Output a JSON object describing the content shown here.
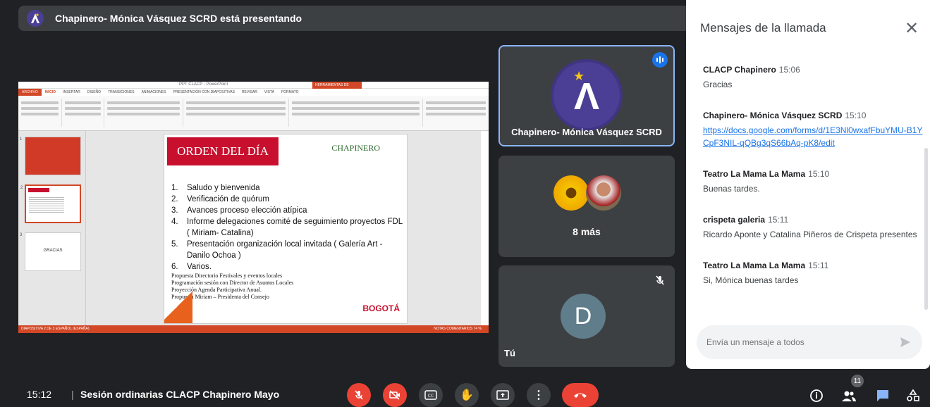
{
  "banner": {
    "text": "Chapinero- Mónica Vásquez SCRD está presentando"
  },
  "presentation": {
    "window_title": "PPT CLACP - PowerPoint",
    "drawing_tools": "HERRAMIENTAS DE DIBUJO",
    "tabs": [
      "ARCHIVO",
      "INICIO",
      "INSERTAR",
      "DISEÑO",
      "TRANSICIONES",
      "ANIMACIONES",
      "PRESENTACIÓN CON DIAPOSITIVAS",
      "REVISAR",
      "VISTA",
      "FORMATO"
    ],
    "thumb3_text": "GRACIAS",
    "slide": {
      "title": "ORDEN DEL DÍA",
      "header_right": "CHAPINERO",
      "items": [
        {
          "num": "1.",
          "text": "Saludo y bienvenida"
        },
        {
          "num": "2.",
          "text": "Verificación de quórum"
        },
        {
          "num": "3.",
          "text": "Avances proceso elección atípica"
        },
        {
          "num": "4.",
          "text": "Informe delegaciones comité de seguimiento proyectos FDL ( Miriam- Catalina)"
        },
        {
          "num": "5.",
          "text": "Presentación organización local  invitada ( Galería Art - Danilo Ochoa )"
        },
        {
          "num": "6.",
          "text": "Varios."
        }
      ],
      "sub_items": [
        "Propuesta Directorio Festivales y eventos locales",
        "Programación sesión con Director de Asuntos Locales",
        "Proyección Agenda Participativa Anual.",
        "Propuesta Miriam – Presidenta del Consejo"
      ],
      "logo": "BOGOTÁ"
    },
    "status_left": "DIAPOSITIVA 2 DE 3   ESPAÑOL (ESPAÑA)",
    "status_right": "NOTAS   COMENTARIOS   74 %"
  },
  "tiles": {
    "presenter_name": "Chapinero- Mónica Vásquez SCRD",
    "more_label": "8 más",
    "self_initial": "D",
    "self_label": "Tú"
  },
  "chat": {
    "title": "Mensajes de la llamada",
    "messages": [
      {
        "sender": "CLACP Chapinero",
        "time": "15:06",
        "text": "Gracias"
      },
      {
        "sender": "Chapinero- Mónica Vásquez SCRD",
        "time": "15:10",
        "text": "https://docs.google.com/forms/d/1E3Nl0wxafFbuYMU-B1YCpF3NIL-qQBg3qS66bAq-pK8/edit"
      },
      {
        "sender": "Teatro La Mama La Mama",
        "time": "15:10",
        "text": "Buenas tardes."
      },
      {
        "sender": "crispeta galeria",
        "time": "15:11",
        "text": "Ricardo Aponte y Catalina Piñeros de Crispeta presentes"
      },
      {
        "sender": "Teatro La Mama La Mama",
        "time": "15:11",
        "text": "Si, Mónica buenas tardes"
      }
    ],
    "input_placeholder": "Envía un mensaje a todos"
  },
  "bottom": {
    "time": "15:12",
    "meeting_name": "Sesión ordinarias CLACP Chapinero Mayo",
    "participants_count": "11"
  },
  "colors": {
    "accent": "#1a73e8",
    "danger": "#ea4335",
    "ppt": "#d24726"
  }
}
